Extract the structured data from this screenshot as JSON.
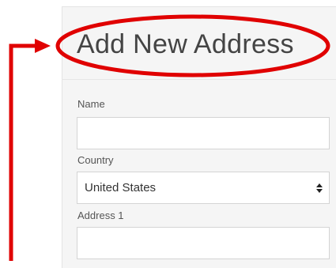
{
  "form": {
    "title": "Add New Address",
    "name_label": "Name",
    "name_value": "",
    "country_label": "Country",
    "country_selected": "United States",
    "address1_label": "Address 1",
    "address1_value": ""
  },
  "annotation": {
    "highlight_color": "#e00000"
  }
}
